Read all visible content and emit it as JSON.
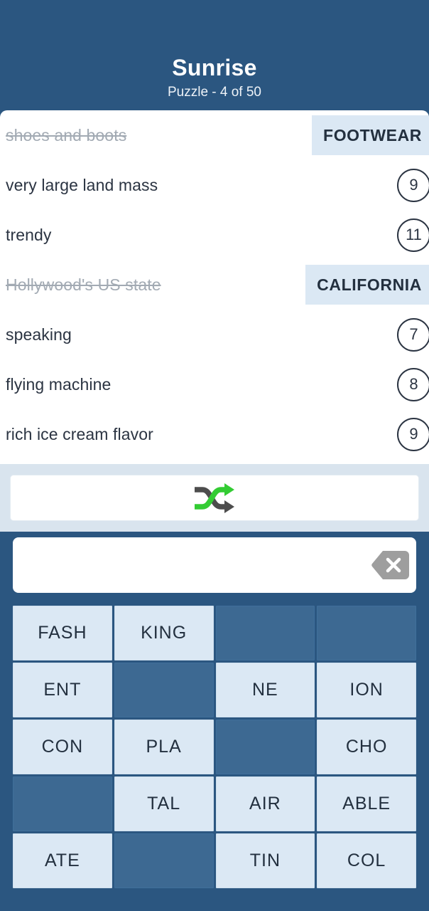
{
  "header": {
    "title": "Sunrise",
    "subtitle": "Puzzle - 4 of 50"
  },
  "colors": {
    "app_blue": "#2b5680",
    "chip_blue": "#dbe8f4",
    "tile_blue": "#dbe8f4",
    "empty_tile_blue": "#3d6992",
    "shuffle_bar": "#d9e4ee",
    "text_dark": "#2b3442",
    "text_struck": "#a2aab3",
    "shuffle_green": "#33cc33",
    "shuffle_gray": "#4d4d4d",
    "backspace_gray": "#9e9e9e"
  },
  "clues": [
    {
      "text": "shoes and boots",
      "solved": true,
      "answer": "FOOTWEAR",
      "count": ""
    },
    {
      "text": "very large land mass",
      "solved": false,
      "answer": "",
      "count": "9"
    },
    {
      "text": "trendy",
      "solved": false,
      "answer": "",
      "count": "11"
    },
    {
      "text": "Hollywood's US state",
      "solved": true,
      "answer": "CALIFORNIA",
      "count": ""
    },
    {
      "text": "speaking",
      "solved": false,
      "answer": "",
      "count": "7"
    },
    {
      "text": "flying machine",
      "solved": false,
      "answer": "",
      "count": "8"
    },
    {
      "text": "rich ice cream flavor",
      "solved": false,
      "answer": "",
      "count": "9"
    }
  ],
  "shuffle": {
    "icon": "shuffle-icon",
    "label": ""
  },
  "answer_input": {
    "value": "",
    "placeholder": "",
    "backspace_icon": "backspace-icon"
  },
  "tiles": [
    {
      "label": "FASH",
      "empty": false
    },
    {
      "label": "KING",
      "empty": false
    },
    {
      "label": "",
      "empty": true
    },
    {
      "label": "",
      "empty": true
    },
    {
      "label": "ENT",
      "empty": false
    },
    {
      "label": "",
      "empty": true
    },
    {
      "label": "NE",
      "empty": false
    },
    {
      "label": "ION",
      "empty": false
    },
    {
      "label": "CON",
      "empty": false
    },
    {
      "label": "PLA",
      "empty": false
    },
    {
      "label": "",
      "empty": true
    },
    {
      "label": "CHO",
      "empty": false
    },
    {
      "label": "",
      "empty": true
    },
    {
      "label": "TAL",
      "empty": false
    },
    {
      "label": "AIR",
      "empty": false
    },
    {
      "label": "ABLE",
      "empty": false
    },
    {
      "label": "ATE",
      "empty": false
    },
    {
      "label": "",
      "empty": true
    },
    {
      "label": "TIN",
      "empty": false
    },
    {
      "label": "COL",
      "empty": false
    }
  ]
}
